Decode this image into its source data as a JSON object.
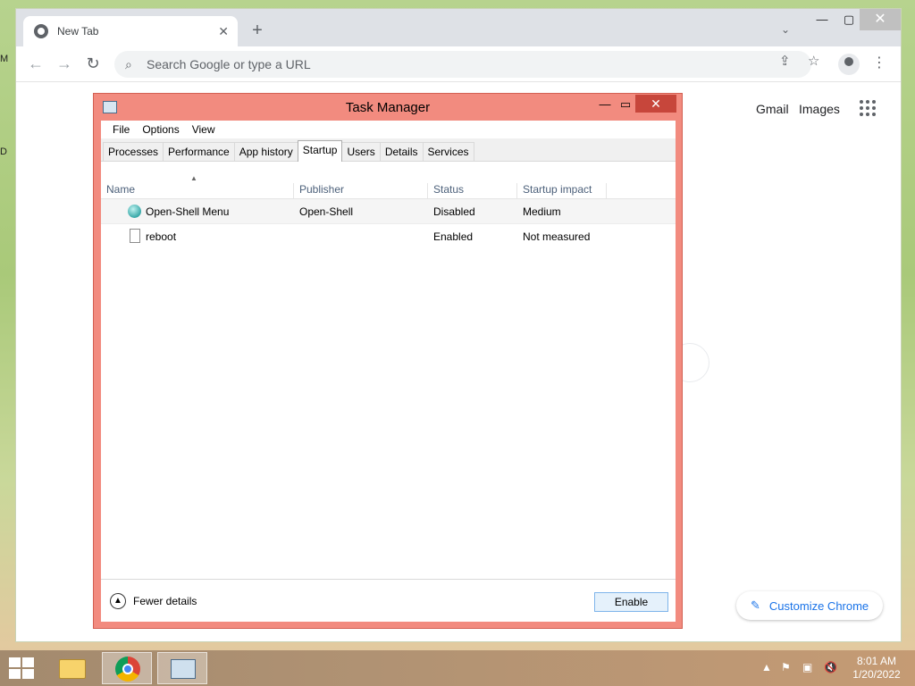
{
  "chrome": {
    "tab_title": "New Tab",
    "omnibox_placeholder": "Search Google or type a URL",
    "links": {
      "gmail": "Gmail",
      "images": "Images"
    },
    "customize_label": "Customize Chrome"
  },
  "task_manager": {
    "title": "Task Manager",
    "menu": [
      "File",
      "Options",
      "View"
    ],
    "tabs": [
      "Processes",
      "Performance",
      "App history",
      "Startup",
      "Users",
      "Details",
      "Services"
    ],
    "active_tab": "Startup",
    "columns": [
      "Name",
      "Publisher",
      "Status",
      "Startup impact"
    ],
    "rows": [
      {
        "name": "Open-Shell Menu",
        "publisher": "Open-Shell",
        "status": "Disabled",
        "impact": "Medium",
        "icon": "open-shell-icon"
      },
      {
        "name": "reboot",
        "publisher": "",
        "status": "Enabled",
        "impact": "Not measured",
        "icon": "file-icon"
      }
    ],
    "fewer_details": "Fewer details",
    "enable_button": "Enable"
  },
  "taskbar": {
    "time": "8:01 AM",
    "date": "1/20/2022"
  }
}
